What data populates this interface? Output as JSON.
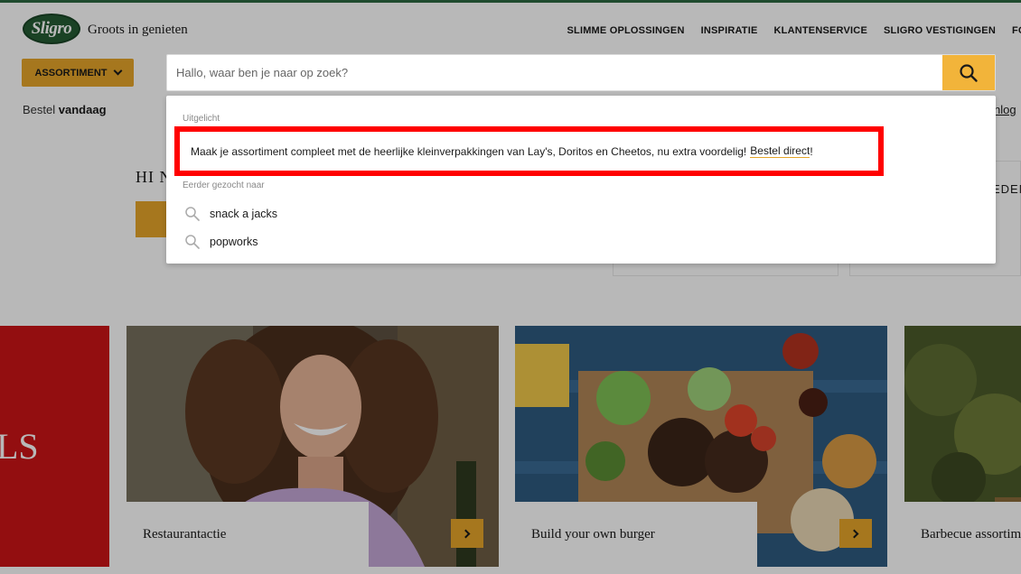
{
  "header": {
    "logo_text": "Sligro",
    "tagline": "Groots in genieten",
    "nav": [
      "SLIMME OPLOSSINGEN",
      "INSPIRATIE",
      "KLANTENSERVICE",
      "SLIGRO VESTIGINGEN",
      "FO"
    ],
    "assortiment_label": "ASSORTIMENT",
    "bestel_prefix": "Bestel",
    "bestel_bold": "vandaag",
    "inlog_label": "nlog"
  },
  "search": {
    "placeholder": "Hallo, waar ben je naar op zoek?",
    "button_icon": "search-icon"
  },
  "dropdown": {
    "featured_heading": "Uitgelicht",
    "featured_text": "Maak je assortiment compleet met de heerlijke kleinverpakkingen van Lay's, Doritos en Cheetos, nu extra voordelig!",
    "featured_link": "Bestel direct",
    "featured_suffix": "!",
    "history_heading": "Eerder gezocht naar",
    "history": [
      "snack a jacks",
      "popworks"
    ]
  },
  "page": {
    "greeting": "HI N",
    "side_text": "EDEN",
    "red_tile_text": "LS",
    "tiles": [
      {
        "caption": "Restaurantactie"
      },
      {
        "caption": "Build your own burger"
      },
      {
        "caption": "Barbecue assortim"
      }
    ]
  },
  "colors": {
    "brand_green": "#245c34",
    "accent_yellow": "#f2b43a",
    "highlight_red": "#ff0000"
  }
}
